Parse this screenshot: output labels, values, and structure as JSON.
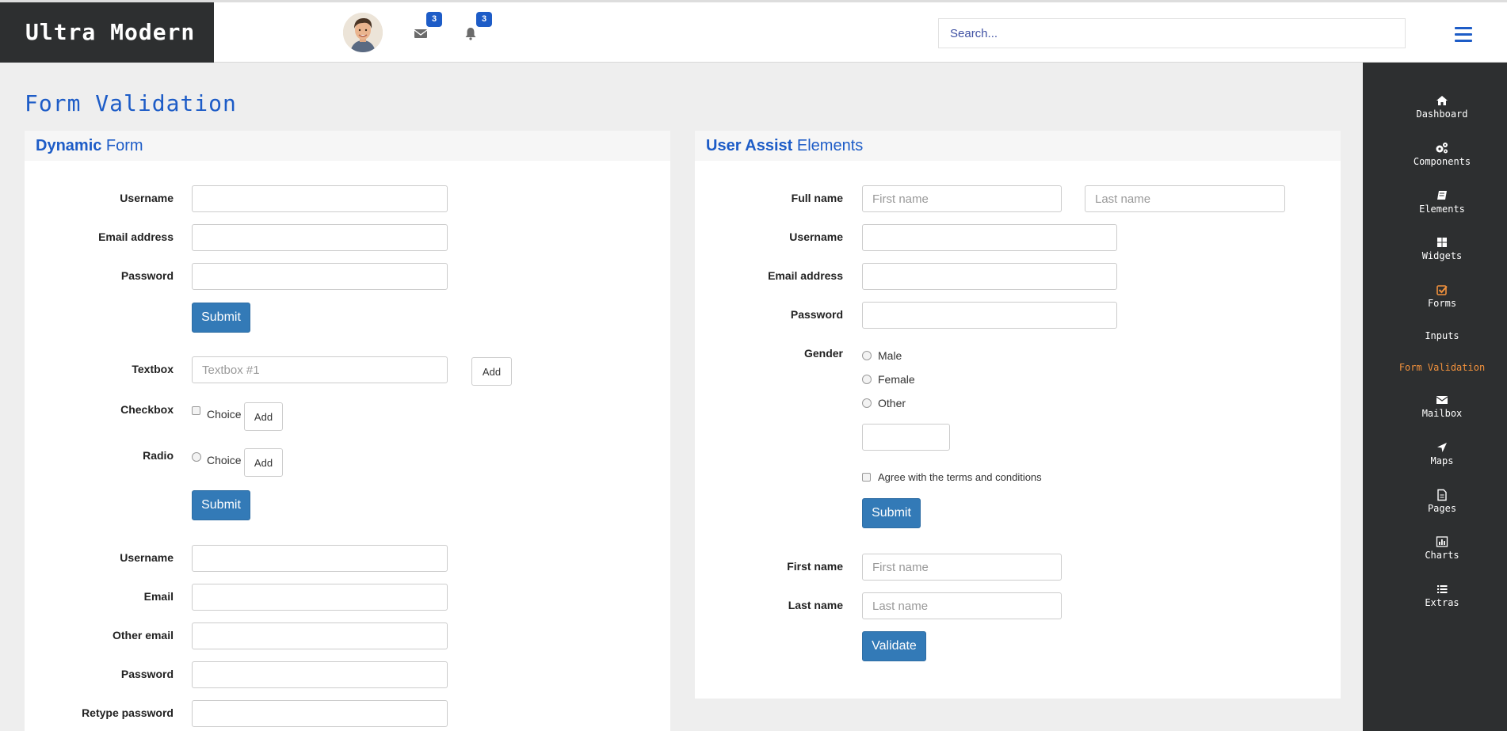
{
  "topbar": {
    "brand": "Ultra Modern",
    "mail_badge": "3",
    "notifications_badge": "3",
    "search_placeholder": "Search..."
  },
  "sidebar": {
    "items": [
      {
        "label": "Dashboard",
        "icon": "home-icon"
      },
      {
        "label": "Components",
        "icon": "gears-icon"
      },
      {
        "label": "Elements",
        "icon": "book-icon"
      },
      {
        "label": "Widgets",
        "icon": "grid-icon"
      },
      {
        "label": "Forms",
        "icon": "check-square-icon"
      },
      {
        "label": "Inputs"
      },
      {
        "label": "Form Validation"
      },
      {
        "label": "Mailbox",
        "icon": "envelope-icon"
      },
      {
        "label": "Maps",
        "icon": "location-arrow-icon"
      },
      {
        "label": "Pages",
        "icon": "file-icon"
      },
      {
        "label": "Charts",
        "icon": "bar-chart-icon"
      },
      {
        "label": "Extras",
        "icon": "list-icon"
      }
    ]
  },
  "page": {
    "title": "Form Validation"
  },
  "dynamic_form": {
    "title_bold": "Dynamic",
    "title_rest": " Form",
    "username_label": "Username",
    "email_label": "Email address",
    "password_label": "Password",
    "submit_label": "Submit",
    "textbox_label": "Textbox",
    "textbox_placeholder": "Textbox #1",
    "add_label": "Add",
    "checkbox_label": "Checkbox",
    "choice_label": "Choice",
    "radio_label": "Radio",
    "submit2_label": "Submit",
    "username2_label": "Username",
    "email2_label": "Email",
    "other_email_label": "Other email",
    "password2_label": "Password",
    "retype_password_label": "Retype password"
  },
  "user_assist": {
    "title_bold": "User Assist",
    "title_rest": " Elements",
    "fullname_label": "Full name",
    "first_name_placeholder": "First name",
    "last_name_placeholder": "Last name",
    "username_label": "Username",
    "email_label": "Email address",
    "password_label": "Password",
    "gender_label": "Gender",
    "gender_options": [
      "Male",
      "Female",
      "Other"
    ],
    "agree_label": "Agree with the terms and conditions",
    "submit_label": "Submit",
    "first_name_label": "First name",
    "last_name_label": "Last name",
    "validate_label": "Validate"
  },
  "colors": {
    "brand_bg": "#2d2f30",
    "accent_blue": "#1d5cc7",
    "button_primary": "#337ab7",
    "sidebar_active": "#f1913c"
  }
}
